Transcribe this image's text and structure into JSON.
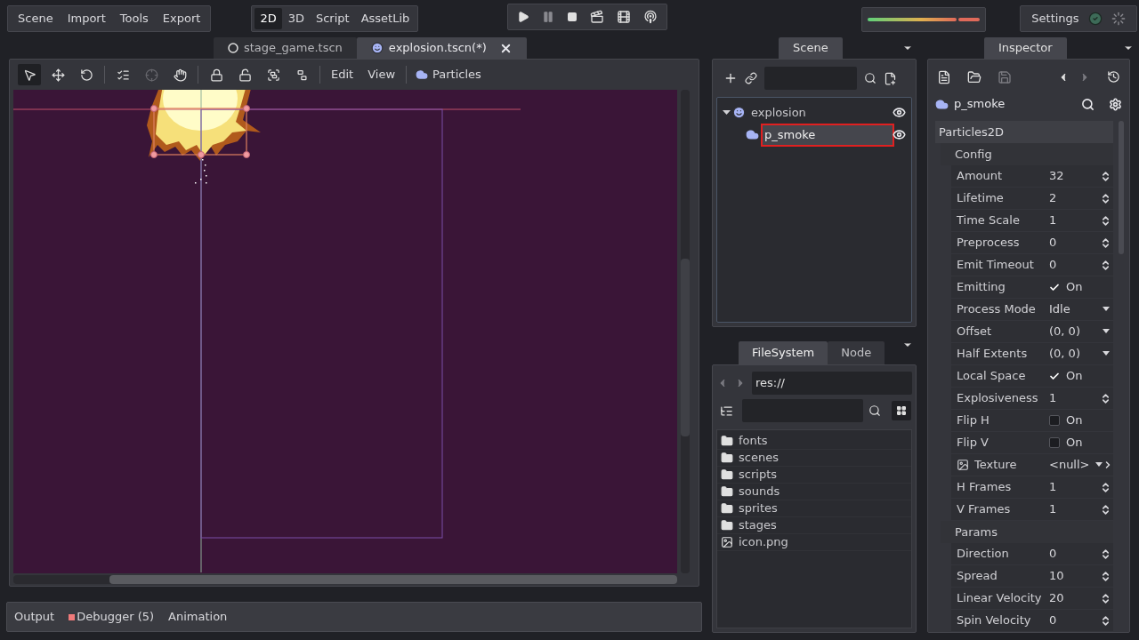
{
  "menus": [
    {
      "label": "Scene"
    },
    {
      "label": "Import"
    },
    {
      "label": "Tools"
    },
    {
      "label": "Export"
    }
  ],
  "workspaces": [
    {
      "label": "2D",
      "selected": true
    },
    {
      "label": "3D",
      "selected": false
    },
    {
      "label": "Script",
      "selected": false
    },
    {
      "label": "AssetLib",
      "selected": false
    }
  ],
  "settings": {
    "label": "Settings"
  },
  "scene_tabs": [
    {
      "label": "stage_game.tscn",
      "kind": "scene",
      "selected": false
    },
    {
      "label": "explosion.tscn(*)",
      "kind": "face",
      "selected": true
    }
  ],
  "viewport": {
    "tools": [
      {
        "kind": "select",
        "selected": true
      },
      {
        "kind": "move",
        "selected": false
      },
      {
        "kind": "rotate",
        "selected": false
      },
      {
        "kind": "list-select",
        "selected": false
      },
      {
        "kind": "pivot",
        "selected": false
      },
      {
        "kind": "pan",
        "selected": false
      },
      {
        "kind": "lock",
        "selected": false
      },
      {
        "kind": "unlock",
        "selected": false
      },
      {
        "kind": "group",
        "selected": false
      },
      {
        "kind": "ungroup",
        "selected": false
      }
    ],
    "menus": [
      {
        "label": "Edit"
      },
      {
        "label": "View"
      }
    ],
    "node_menu": {
      "label": "Particles"
    }
  },
  "bottom_tabs": [
    {
      "label": "Output",
      "kind": "plain"
    },
    {
      "label": "Debugger (5)",
      "kind": "alert",
      "color": "#f07a7a"
    },
    {
      "label": "Animation",
      "kind": "plain"
    }
  ],
  "scene_dock": {
    "tab": "Scene",
    "tree": [
      {
        "name": "explosion",
        "kind": "root",
        "expanded": true,
        "selected": false,
        "children": [
          {
            "name": "p_smoke",
            "kind": "particles",
            "selected": true
          }
        ]
      }
    ]
  },
  "filesystem": {
    "tabs": [
      {
        "label": "FileSystem",
        "selected": true
      },
      {
        "label": "Node",
        "selected": false
      }
    ],
    "path": "res://",
    "items": [
      {
        "name": "fonts",
        "kind": "folder"
      },
      {
        "name": "scenes",
        "kind": "folder"
      },
      {
        "name": "scripts",
        "kind": "folder"
      },
      {
        "name": "sounds",
        "kind": "folder"
      },
      {
        "name": "sprites",
        "kind": "folder"
      },
      {
        "name": "stages",
        "kind": "folder"
      },
      {
        "name": "icon.png",
        "kind": "image"
      }
    ]
  },
  "inspector": {
    "tab": "Inspector",
    "node": "p_smoke",
    "class": "Particles2D",
    "groups": [
      {
        "title": "Config",
        "properties": [
          {
            "name": "Amount",
            "kind": "spin",
            "value": "32"
          },
          {
            "name": "Lifetime",
            "kind": "spin",
            "value": "2"
          },
          {
            "name": "Time Scale",
            "kind": "spin",
            "value": "1"
          },
          {
            "name": "Preprocess",
            "kind": "spin",
            "value": "0"
          },
          {
            "name": "Emit Timeout",
            "kind": "spin",
            "value": "0"
          },
          {
            "name": "Emitting",
            "kind": "check",
            "checked": true,
            "value": "On"
          },
          {
            "name": "Process Mode",
            "kind": "enum",
            "value": "Idle"
          },
          {
            "name": "Offset",
            "kind": "enum",
            "value": "(0, 0)"
          },
          {
            "name": "Half Extents",
            "kind": "enum",
            "value": "(0, 0)"
          },
          {
            "name": "Local Space",
            "kind": "check",
            "checked": true,
            "value": "On"
          },
          {
            "name": "Explosiveness",
            "kind": "spin",
            "value": "1"
          },
          {
            "name": "Flip H",
            "kind": "check",
            "checked": false,
            "value": "On"
          },
          {
            "name": "Flip V",
            "kind": "check",
            "checked": false,
            "value": "On"
          },
          {
            "name": "Texture",
            "kind": "resource",
            "value": "<null>"
          },
          {
            "name": "H Frames",
            "kind": "spin",
            "value": "1"
          },
          {
            "name": "V Frames",
            "kind": "spin",
            "value": "1"
          }
        ]
      },
      {
        "title": "Params",
        "properties": [
          {
            "name": "Direction",
            "kind": "spin",
            "value": "0"
          },
          {
            "name": "Spread",
            "kind": "spin",
            "value": "10"
          },
          {
            "name": "Linear Velocity",
            "kind": "spin",
            "value": "20"
          },
          {
            "name": "Spin Velocity",
            "kind": "spin",
            "value": "0"
          }
        ]
      }
    ]
  }
}
